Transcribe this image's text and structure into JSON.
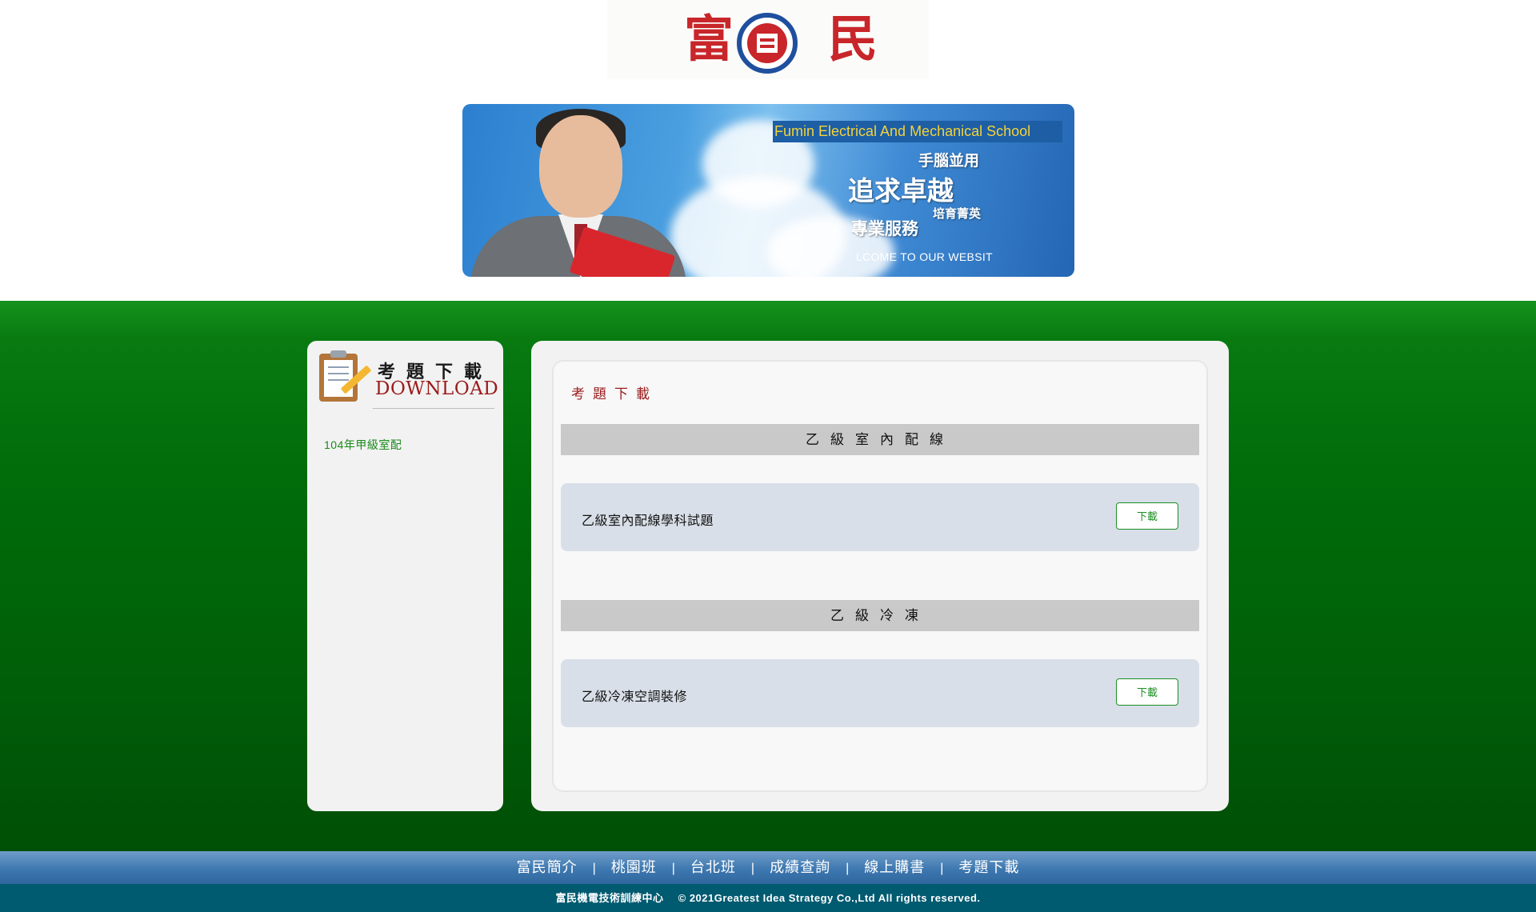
{
  "logo": {
    "char_left": "富",
    "char_right": "民"
  },
  "banner": {
    "school_name": "Fumin Electrical And Mechanical School",
    "slogan_1": "手腦並用",
    "slogan_2": "追求卓越",
    "slogan_3": "培育菁英",
    "slogan_4": "專業服務",
    "welcome": "LCOME TO OUR WEBSIT"
  },
  "sidebar": {
    "title_zh": "考題下載",
    "title_en": "DOWNLOAD",
    "items": [
      {
        "label": "104年甲級室配"
      }
    ]
  },
  "main": {
    "heading": "考題下載",
    "sections": [
      {
        "title": "乙級室內配線",
        "items": [
          {
            "label": "乙級室內配線學科試題",
            "button": "下載"
          }
        ]
      },
      {
        "title": "乙級冷凍",
        "items": [
          {
            "label": "乙級冷凍空調裝修",
            "button": "下載"
          }
        ]
      }
    ]
  },
  "nav": {
    "items": [
      {
        "label": "富民簡介"
      },
      {
        "label": "桃園班"
      },
      {
        "label": "台北班"
      },
      {
        "label": "成績查詢"
      },
      {
        "label": "線上購書"
      },
      {
        "label": "考題下載"
      }
    ],
    "separator": "|"
  },
  "footer": {
    "org": "富民機電技術訓練中心",
    "copyright": "© 2021Greatest Idea Strategy Co.,Ltd All rights reserved."
  },
  "colors": {
    "green": "#006d0a",
    "nav_blue": "#3e78b0",
    "footer_teal": "#005a70",
    "heading_red": "#9b1b1b",
    "button_green": "#1c8f23"
  }
}
